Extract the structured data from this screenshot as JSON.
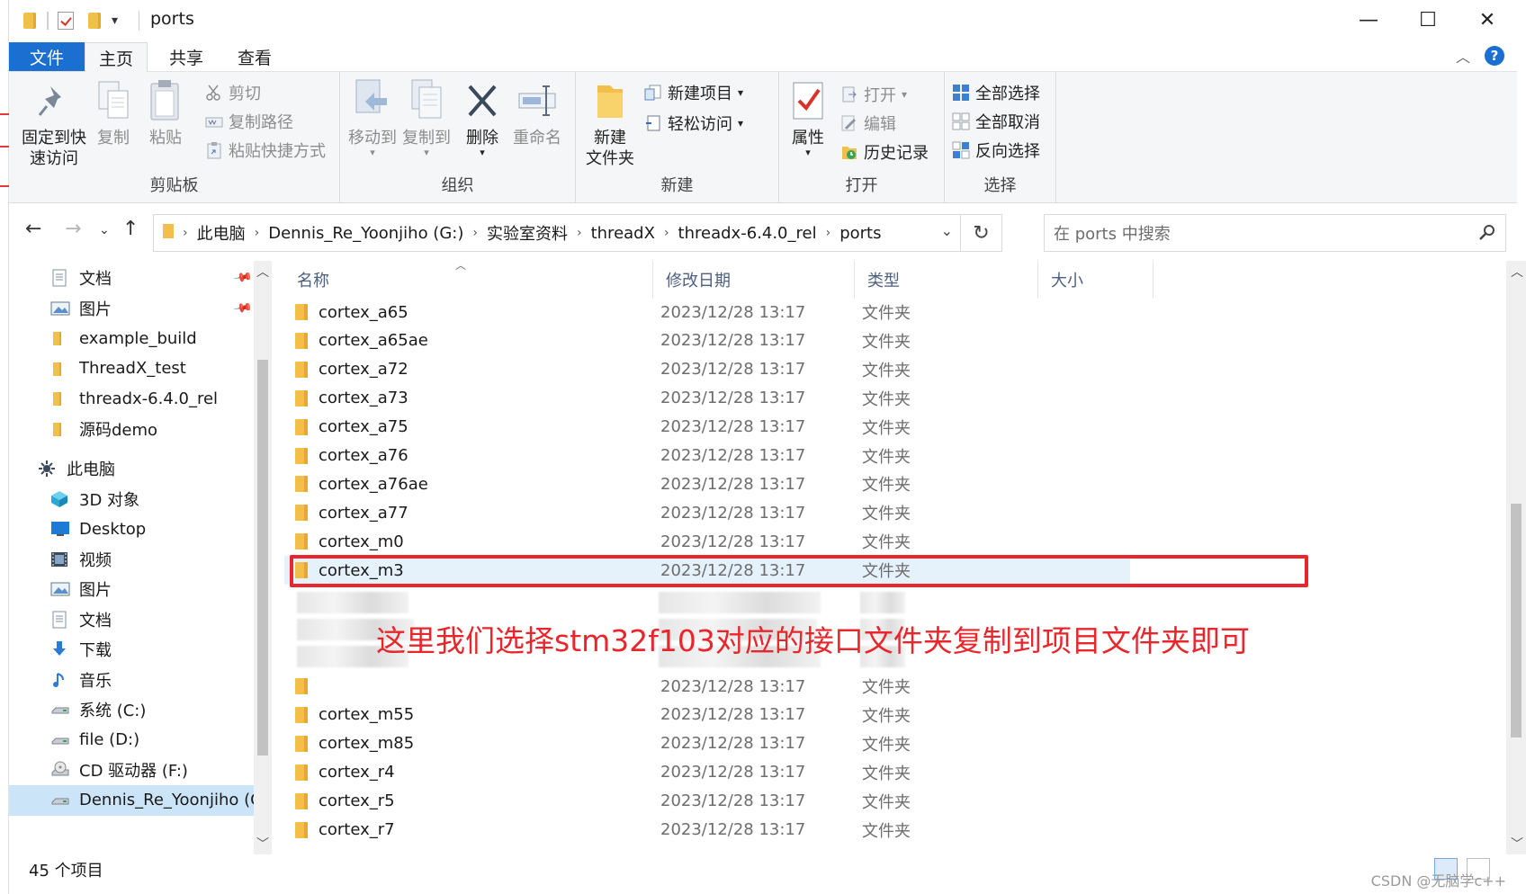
{
  "window": {
    "title": "ports",
    "controls": {
      "minimize": "—",
      "maximize": "☐",
      "close": "✕"
    }
  },
  "ribbon_tabs": [
    "文件",
    "主页",
    "共享",
    "查看"
  ],
  "ribbon": {
    "clipboard": {
      "label": "剪贴板",
      "pin": "固定到快\n速访问",
      "copy": "复制",
      "paste": "粘贴",
      "cut": "剪切",
      "copy_path": "复制路径",
      "paste_shortcut": "粘贴快捷方式"
    },
    "organize": {
      "label": "组织",
      "move_to": "移动到",
      "copy_to": "复制到",
      "delete": "删除",
      "rename": "重命名"
    },
    "new": {
      "label": "新建",
      "new_folder": "新建\n文件夹",
      "new_item": "新建项目",
      "easy_access": "轻松访问"
    },
    "open": {
      "label": "打开",
      "properties": "属性",
      "open": "打开",
      "edit": "编辑",
      "history": "历史记录"
    },
    "select": {
      "label": "选择",
      "select_all": "全部选择",
      "select_none": "全部取消",
      "invert": "反向选择"
    }
  },
  "address": {
    "crumbs": [
      "此电脑",
      "Dennis_Re_Yoonjiho (G:)",
      "实验室资料",
      "threadX",
      "threadx-6.4.0_rel",
      "ports"
    ],
    "search_placeholder": "在 ports 中搜索"
  },
  "nav_pane": {
    "quick": [
      {
        "label": "文档",
        "icon": "document-icon",
        "pinned": true
      },
      {
        "label": "图片",
        "icon": "picture-icon",
        "pinned": true
      },
      {
        "label": "example_build",
        "icon": "folder-icon"
      },
      {
        "label": "ThreadX_test",
        "icon": "folder-icon"
      },
      {
        "label": "threadx-6.4.0_rel",
        "icon": "folder-icon"
      },
      {
        "label": "源码demo",
        "icon": "folder-icon"
      }
    ],
    "this_pc": "此电脑",
    "pc_items": [
      {
        "label": "3D 对象",
        "icon": "cube-icon"
      },
      {
        "label": "Desktop",
        "icon": "desktop-icon"
      },
      {
        "label": "视频",
        "icon": "video-icon"
      },
      {
        "label": "图片",
        "icon": "picture-icon"
      },
      {
        "label": "文档",
        "icon": "document-icon"
      },
      {
        "label": "下载",
        "icon": "download-icon"
      },
      {
        "label": "音乐",
        "icon": "music-icon"
      },
      {
        "label": "系统 (C:)",
        "icon": "drive-icon"
      },
      {
        "label": "file (D:)",
        "icon": "drive-icon"
      },
      {
        "label": "CD 驱动器 (F:)",
        "icon": "cd-drive-icon"
      },
      {
        "label": "Dennis_Re_Yoonjiho (G:)",
        "icon": "drive-icon"
      }
    ]
  },
  "columns": {
    "name": "名称",
    "date": "修改日期",
    "type": "类型",
    "size": "大小"
  },
  "files_top": [
    {
      "name": "cortex_a65",
      "date": "2023/12/28 13:17",
      "type": "文件夹"
    },
    {
      "name": "cortex_a65ae",
      "date": "2023/12/28 13:17",
      "type": "文件夹"
    },
    {
      "name": "cortex_a72",
      "date": "2023/12/28 13:17",
      "type": "文件夹"
    },
    {
      "name": "cortex_a73",
      "date": "2023/12/28 13:17",
      "type": "文件夹"
    },
    {
      "name": "cortex_a75",
      "date": "2023/12/28 13:17",
      "type": "文件夹"
    },
    {
      "name": "cortex_a76",
      "date": "2023/12/28 13:17",
      "type": "文件夹"
    },
    {
      "name": "cortex_a76ae",
      "date": "2023/12/28 13:17",
      "type": "文件夹"
    },
    {
      "name": "cortex_a77",
      "date": "2023/12/28 13:17",
      "type": "文件夹"
    },
    {
      "name": "cortex_m0",
      "date": "2023/12/28 13:17",
      "type": "文件夹"
    },
    {
      "name": "cortex_m3",
      "date": "2023/12/28 13:17",
      "type": "文件夹"
    }
  ],
  "files_bottom": [
    {
      "name": "",
      "date": "2023/12/28 13:17",
      "type": "文件夹"
    },
    {
      "name": "cortex_m55",
      "date": "2023/12/28 13:17",
      "type": "文件夹"
    },
    {
      "name": "cortex_m85",
      "date": "2023/12/28 13:17",
      "type": "文件夹"
    },
    {
      "name": "cortex_r4",
      "date": "2023/12/28 13:17",
      "type": "文件夹"
    },
    {
      "name": "cortex_r5",
      "date": "2023/12/28 13:17",
      "type": "文件夹"
    },
    {
      "name": "cortex_r7",
      "date": "2023/12/28 13:17",
      "type": "文件夹"
    }
  ],
  "annotation": "这里我们选择stm32f103对应的接口文件夹复制到项目文件夹即可",
  "status": {
    "item_count": "45 个项目"
  },
  "watermark": "CSDN @无脑学c++",
  "colors": {
    "accent": "#1a6fd1",
    "highlight": "#e8262b",
    "selected_row": "#e5f1fb"
  }
}
